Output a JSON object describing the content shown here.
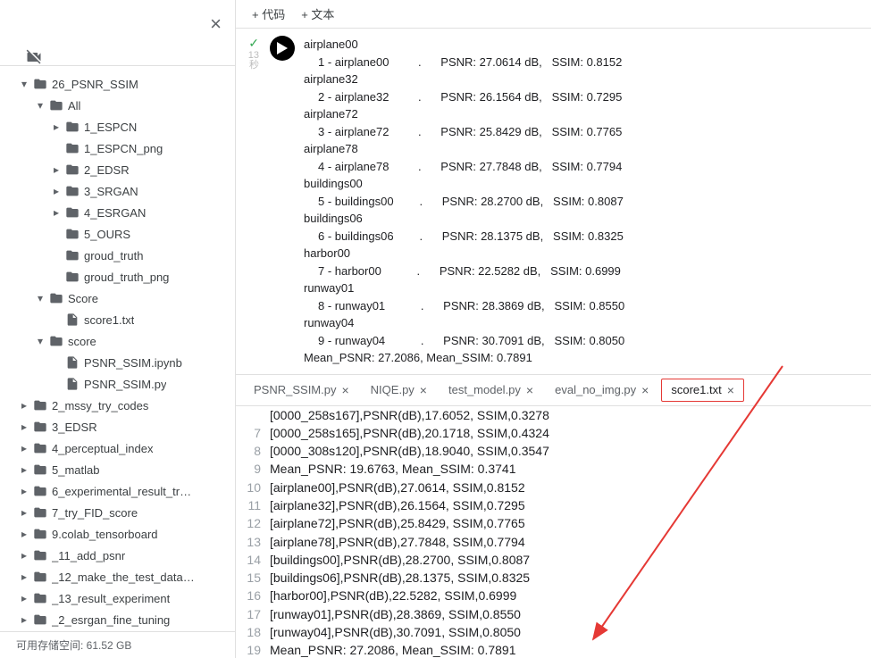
{
  "sidebar": {
    "close_label": "×"
  },
  "file_tree": [
    {
      "depth": 0,
      "type": "folder",
      "open": true,
      "name": "26_PSNR_SSIM",
      "chev": "▾"
    },
    {
      "depth": 1,
      "type": "folder",
      "open": true,
      "name": "All",
      "chev": "▾"
    },
    {
      "depth": 2,
      "type": "folder",
      "open": false,
      "name": "1_ESPCN",
      "chev": "▸"
    },
    {
      "depth": 2,
      "type": "folder",
      "open": false,
      "name": "1_ESPCN_png",
      "chev": ""
    },
    {
      "depth": 2,
      "type": "folder",
      "open": false,
      "name": "2_EDSR",
      "chev": "▸"
    },
    {
      "depth": 2,
      "type": "folder",
      "open": false,
      "name": "3_SRGAN",
      "chev": "▸"
    },
    {
      "depth": 2,
      "type": "folder",
      "open": false,
      "name": "4_ESRGAN",
      "chev": "▸"
    },
    {
      "depth": 2,
      "type": "folder",
      "open": false,
      "name": "5_OURS",
      "chev": ""
    },
    {
      "depth": 2,
      "type": "folder",
      "open": false,
      "name": "groud_truth",
      "chev": ""
    },
    {
      "depth": 2,
      "type": "folder",
      "open": false,
      "name": "groud_truth_png",
      "chev": ""
    },
    {
      "depth": 1,
      "type": "folder",
      "open": true,
      "name": "Score",
      "chev": "▾"
    },
    {
      "depth": 2,
      "type": "file",
      "open": false,
      "name": "score1.txt",
      "chev": ""
    },
    {
      "depth": 1,
      "type": "folder",
      "open": true,
      "name": "score",
      "chev": "▾"
    },
    {
      "depth": 2,
      "type": "file",
      "open": false,
      "name": "PSNR_SSIM.ipynb",
      "chev": ""
    },
    {
      "depth": 2,
      "type": "file",
      "open": false,
      "name": "PSNR_SSIM.py",
      "chev": ""
    },
    {
      "depth": 0,
      "type": "folder",
      "open": false,
      "name": "2_mssy_try_codes",
      "chev": "▸"
    },
    {
      "depth": 0,
      "type": "folder",
      "open": false,
      "name": "3_EDSR",
      "chev": "▸"
    },
    {
      "depth": 0,
      "type": "folder",
      "open": false,
      "name": "4_perceptual_index",
      "chev": "▸"
    },
    {
      "depth": 0,
      "type": "folder",
      "open": false,
      "name": "5_matlab",
      "chev": "▸"
    },
    {
      "depth": 0,
      "type": "folder",
      "open": false,
      "name": "6_experimental_result_tr…",
      "chev": "▸"
    },
    {
      "depth": 0,
      "type": "folder",
      "open": false,
      "name": "7_try_FID_score",
      "chev": "▸"
    },
    {
      "depth": 0,
      "type": "folder",
      "open": false,
      "name": "9.colab_tensorboard",
      "chev": "▸"
    },
    {
      "depth": 0,
      "type": "folder",
      "open": false,
      "name": "_11_add_psnr",
      "chev": "▸"
    },
    {
      "depth": 0,
      "type": "folder",
      "open": false,
      "name": "_12_make_the_test_data…",
      "chev": "▸"
    },
    {
      "depth": 0,
      "type": "folder",
      "open": false,
      "name": "_13_result_experiment",
      "chev": "▸"
    },
    {
      "depth": 0,
      "type": "folder",
      "open": false,
      "name": "_2_esrgan_fine_tuning",
      "chev": "▸"
    }
  ],
  "footer_text": "可用存储空间: 61.52 GB",
  "toolbar": {
    "code_btn": "+ 代码",
    "text_btn": "+ 文本"
  },
  "cell": {
    "timing1": "13",
    "timing2": "秒",
    "output": [
      {
        "cls": "",
        "text": "airplane00"
      },
      {
        "cls": "ind1",
        "text": "1 - airplane00         .      PSNR: 27.0614 dB,   SSIM: 0.8152"
      },
      {
        "cls": "",
        "text": "airplane32"
      },
      {
        "cls": "ind1",
        "text": "2 - airplane32         .      PSNR: 26.1564 dB,   SSIM: 0.7295"
      },
      {
        "cls": "",
        "text": "airplane72"
      },
      {
        "cls": "ind1",
        "text": "3 - airplane72         .      PSNR: 25.8429 dB,   SSIM: 0.7765"
      },
      {
        "cls": "",
        "text": "airplane78"
      },
      {
        "cls": "ind1",
        "text": "4 - airplane78         .      PSNR: 27.7848 dB,   SSIM: 0.7794"
      },
      {
        "cls": "",
        "text": "buildings00"
      },
      {
        "cls": "ind1",
        "text": "5 - buildings00        .      PSNR: 28.2700 dB,   SSIM: 0.8087"
      },
      {
        "cls": "",
        "text": "buildings06"
      },
      {
        "cls": "ind1",
        "text": "6 - buildings06        .      PSNR: 28.1375 dB,   SSIM: 0.8325"
      },
      {
        "cls": "",
        "text": "harbor00"
      },
      {
        "cls": "ind1",
        "text": "7 - harbor00           .      PSNR: 22.5282 dB,   SSIM: 0.6999"
      },
      {
        "cls": "",
        "text": "runway01"
      },
      {
        "cls": "ind1",
        "text": "8 - runway01           .      PSNR: 28.3869 dB,   SSIM: 0.8550"
      },
      {
        "cls": "",
        "text": "runway04"
      },
      {
        "cls": "ind1",
        "text": "9 - runway04           .      PSNR: 30.7091 dB,   SSIM: 0.8050"
      },
      {
        "cls": "",
        "text": "Mean_PSNR: 27.2086, Mean_SSIM: 0.7891"
      }
    ]
  },
  "tabs": [
    {
      "label": "PSNR_SSIM.py",
      "active": false
    },
    {
      "label": "NIQE.py",
      "active": false
    },
    {
      "label": "test_model.py",
      "active": false
    },
    {
      "label": "eval_no_img.py",
      "active": false
    },
    {
      "label": "score1.txt",
      "active": true
    }
  ],
  "editor_lines": [
    {
      "n": "",
      "text": "[0000_258s167],PSNR(dB),17.6052, SSIM,0.3278"
    },
    {
      "n": "7",
      "text": "[0000_258s165],PSNR(dB),20.1718, SSIM,0.4324"
    },
    {
      "n": "8",
      "text": "[0000_308s120],PSNR(dB),18.9040, SSIM,0.3547"
    },
    {
      "n": "9",
      "text": "Mean_PSNR: 19.6763, Mean_SSIM: 0.3741"
    },
    {
      "n": "10",
      "text": "[airplane00],PSNR(dB),27.0614, SSIM,0.8152"
    },
    {
      "n": "11",
      "text": "[airplane32],PSNR(dB),26.1564, SSIM,0.7295"
    },
    {
      "n": "12",
      "text": "[airplane72],PSNR(dB),25.8429, SSIM,0.7765"
    },
    {
      "n": "13",
      "text": "[airplane78],PSNR(dB),27.7848, SSIM,0.7794"
    },
    {
      "n": "14",
      "text": "[buildings00],PSNR(dB),28.2700, SSIM,0.8087"
    },
    {
      "n": "15",
      "text": "[buildings06],PSNR(dB),28.1375, SSIM,0.8325"
    },
    {
      "n": "16",
      "text": "[harbor00],PSNR(dB),22.5282, SSIM,0.6999"
    },
    {
      "n": "17",
      "text": "[runway01],PSNR(dB),28.3869, SSIM,0.8550"
    },
    {
      "n": "18",
      "text": "[runway04],PSNR(dB),30.7091, SSIM,0.8050"
    },
    {
      "n": "19",
      "text": "Mean_PSNR: 27.2086, Mean_SSIM: 0.7891"
    }
  ]
}
